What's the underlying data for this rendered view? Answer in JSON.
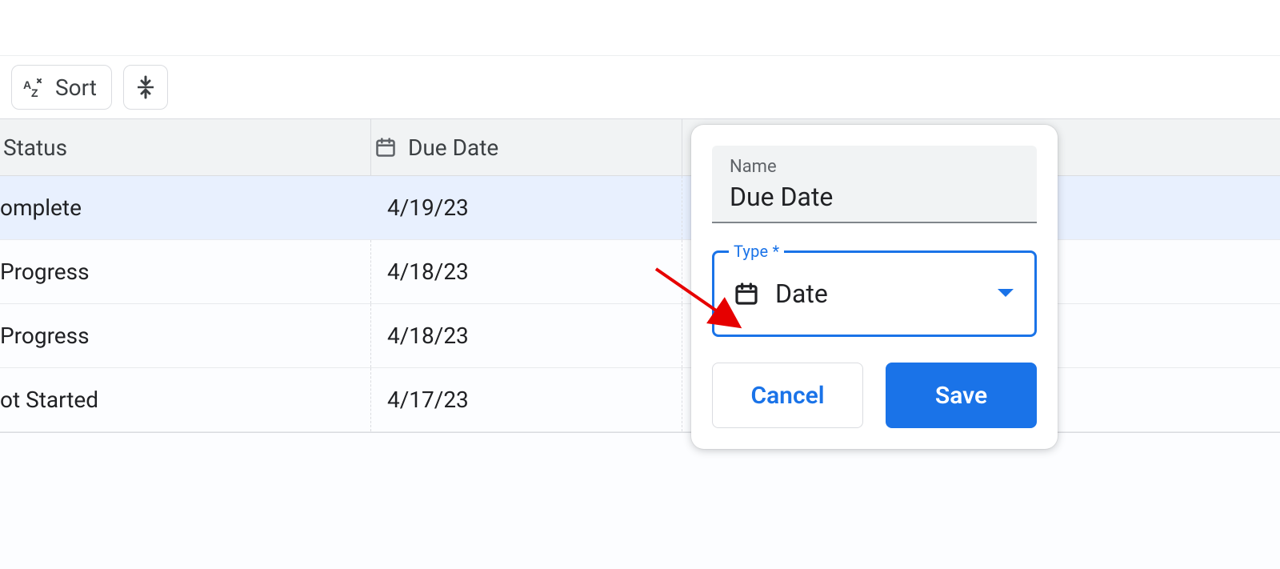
{
  "toolbar": {
    "sort_label": "Sort"
  },
  "columns": {
    "status_label": "Status",
    "due_label": "Due Date"
  },
  "rows": [
    {
      "status": "omplete",
      "due": "4/19/23",
      "selected": true
    },
    {
      "status": "Progress",
      "due": "4/18/23",
      "selected": false
    },
    {
      "status": "Progress",
      "due": "4/18/23",
      "selected": false
    },
    {
      "status": "ot Started",
      "due": "4/17/23",
      "selected": false
    }
  ],
  "popover": {
    "name_label": "Name",
    "name_value": "Due Date",
    "type_label": "Type *",
    "type_value": "Date",
    "cancel_label": "Cancel",
    "save_label": "Save"
  },
  "colors": {
    "accent": "#1a73e8",
    "annotation": "#e60000"
  }
}
